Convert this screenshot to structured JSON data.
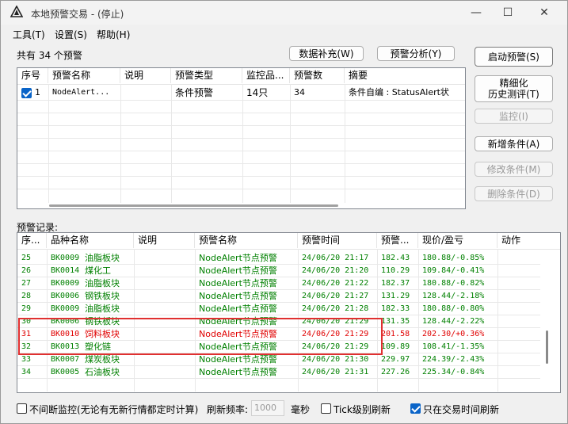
{
  "window": {
    "title": "本地预警交易 - (停止)",
    "minimize_glyph": "—",
    "maximize_glyph": "☐",
    "close_glyph": "✕"
  },
  "menu": [
    {
      "label": "工具(T)"
    },
    {
      "label": "设置(S)"
    },
    {
      "label": "帮助(H)"
    }
  ],
  "summary_text": "共有 34 个预警",
  "top_buttons": {
    "data_fill": "数据补充(W)",
    "alert_analysis": "预警分析(Y)"
  },
  "side_buttons": {
    "start_alert": "启动预警(S)",
    "refine_line1": "精细化",
    "refine_line2": "历史测评(T)",
    "monitor": "监控(I)",
    "add_condition": "新增条件(A)",
    "edit_condition": "修改条件(M)",
    "delete_condition": "删除条件(D)"
  },
  "alerts_table": {
    "columns": [
      "序号",
      "预警名称",
      "说明",
      "预警类型",
      "监控品...",
      "预警数",
      "摘要"
    ],
    "rows": [
      {
        "checked": true,
        "no": "1",
        "name": "NodeAlert...",
        "desc": "",
        "type": "条件预警",
        "monitor": "14只",
        "count": "34",
        "summary": "条件自编 : StatusAlert状"
      }
    ]
  },
  "records_label": "预警记录:",
  "records_table": {
    "columns": [
      "序...",
      "品种名称",
      "说明",
      "预警名称",
      "预警时间",
      "预警...",
      "现价/盈亏",
      "动作"
    ],
    "rows": [
      {
        "no": "25",
        "code": "BK0009",
        "name": "油脂板块",
        "desc": "",
        "alert": "NodeAlert节点预警",
        "time": "24/06/20 21:17",
        "price": "182.43",
        "now": "180.88/-0.85%",
        "action": "",
        "color": "green"
      },
      {
        "no": "26",
        "code": "BK0014",
        "name": "煤化工",
        "desc": "",
        "alert": "NodeAlert节点预警",
        "time": "24/06/20 21:20",
        "price": "110.29",
        "now": "109.84/-0.41%",
        "action": "",
        "color": "green"
      },
      {
        "no": "27",
        "code": "BK0009",
        "name": "油脂板块",
        "desc": "",
        "alert": "NodeAlert节点预警",
        "time": "24/06/20 21:22",
        "price": "182.37",
        "now": "180.88/-0.82%",
        "action": "",
        "color": "green"
      },
      {
        "no": "28",
        "code": "BK0006",
        "name": "钢铁板块",
        "desc": "",
        "alert": "NodeAlert节点预警",
        "time": "24/06/20 21:27",
        "price": "131.29",
        "now": "128.44/-2.18%",
        "action": "",
        "color": "green"
      },
      {
        "no": "29",
        "code": "BK0009",
        "name": "油脂板块",
        "desc": "",
        "alert": "NodeAlert节点预警",
        "time": "24/06/20 21:28",
        "price": "182.33",
        "now": "180.88/-0.80%",
        "action": "",
        "color": "green"
      },
      {
        "no": "30",
        "code": "BK0006",
        "name": "钢铁板块",
        "desc": "",
        "alert": "NodeAlert节点预警",
        "time": "24/06/20 21:29",
        "price": "131.35",
        "now": "128.44/-2.22%",
        "action": "",
        "color": "green"
      },
      {
        "no": "31",
        "code": "BK0010",
        "name": "饲料板块",
        "desc": "",
        "alert": "NodeAlert节点预警",
        "time": "24/06/20 21:29",
        "price": "201.58",
        "now": "202.30/+0.36%",
        "action": "",
        "color": "red"
      },
      {
        "no": "32",
        "code": "BK0013",
        "name": "塑化链",
        "desc": "",
        "alert": "NodeAlert节点预警",
        "time": "24/06/20 21:29",
        "price": "109.89",
        "now": "108.41/-1.35%",
        "action": "",
        "color": "green"
      },
      {
        "no": "33",
        "code": "BK0007",
        "name": "煤炭板块",
        "desc": "",
        "alert": "NodeAlert节点预警",
        "time": "24/06/20 21:30",
        "price": "229.97",
        "now": "224.39/-2.43%",
        "action": "",
        "color": "green"
      },
      {
        "no": "34",
        "code": "BK0005",
        "name": "石油板块",
        "desc": "",
        "alert": "NodeAlert节点预警",
        "time": "24/06/20 21:31",
        "price": "227.26",
        "now": "225.34/-0.84%",
        "action": "",
        "color": "green"
      }
    ]
  },
  "bottom": {
    "continuous_label": "不间断监控(无论有无新行情都定时计算)",
    "continuous_checked": false,
    "freq_label": "刷新频率:",
    "freq_value": "1000",
    "freq_unit": "毫秒",
    "tick_label": "Tick级别刷新",
    "tick_checked": false,
    "trading_only_label": "只在交易时间刷新",
    "trading_only_checked": true
  },
  "colors": {
    "positive": "#e00000",
    "negative": "#008000",
    "accent": "#0a64c8",
    "highlight_box": "#e03030"
  }
}
